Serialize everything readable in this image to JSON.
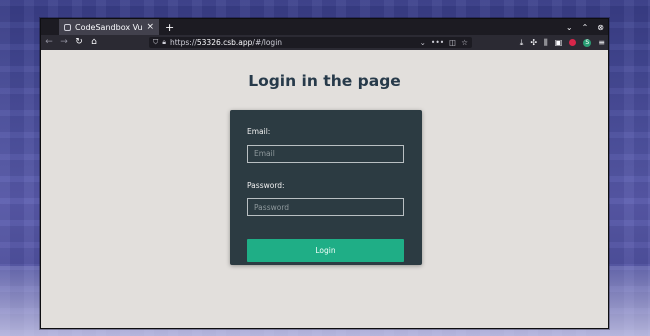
{
  "browser": {
    "tab_title": "CodeSandbox Vue",
    "tab_close": "×",
    "new_tab": "+",
    "url_prefix": "https://",
    "url_host": "53326.csb.app",
    "url_path": "/#/login",
    "url_more": "•••"
  },
  "page": {
    "title": "Login in the page",
    "email_label": "Email:",
    "email_placeholder": "Email",
    "email_value": "",
    "password_label": "Password:",
    "password_placeholder": "Password",
    "password_value": "",
    "login_button": "Login"
  },
  "colors": {
    "card_bg": "#2c3b42",
    "button_bg": "#1fae86",
    "title_color": "#273a4a"
  },
  "icons": {
    "nav": [
      "back-icon",
      "forward-icon",
      "reload-icon",
      "home-icon"
    ],
    "tools": [
      "download-icon",
      "extensions-icon",
      "library-icon",
      "sidebar-icon",
      "red-extension-icon",
      "green-extension-icon",
      "menu-icon"
    ]
  }
}
